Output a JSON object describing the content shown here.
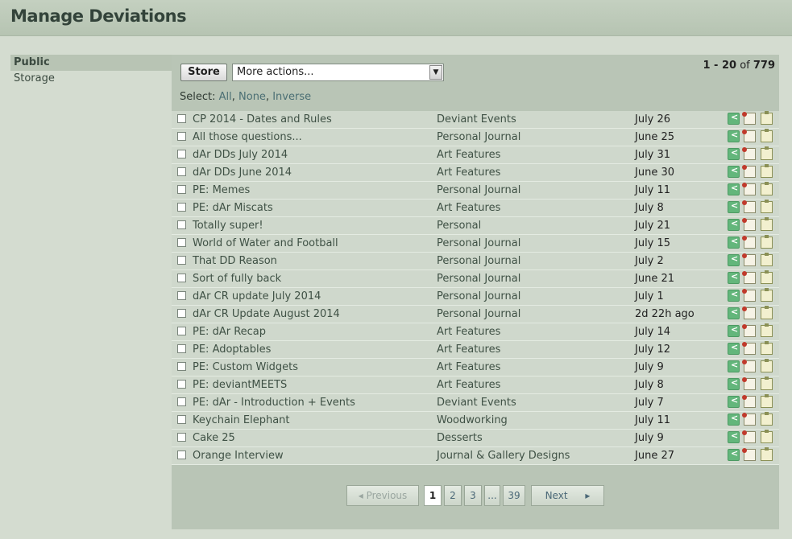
{
  "page": {
    "title": "Manage Deviations"
  },
  "sidebar": {
    "items": [
      {
        "label": "Public"
      },
      {
        "label": "Storage"
      }
    ]
  },
  "toolbar": {
    "store_label": "Store",
    "actions_selected": "More actions...",
    "select_label": "Select:",
    "select_all": "All",
    "select_none": "None",
    "select_inverse": "Inverse",
    "count_range": "1 - 20",
    "count_of": "of",
    "count_total": "779"
  },
  "rows": [
    {
      "title": "CP 2014 - Dates and Rules",
      "category": "Deviant Events",
      "date": "July 26"
    },
    {
      "title": "All those questions...",
      "category": "Personal Journal",
      "date": "June 25"
    },
    {
      "title": "dAr DDs July 2014",
      "category": "Art Features",
      "date": "July 31"
    },
    {
      "title": "dAr DDs June 2014",
      "category": "Art Features",
      "date": "June 30"
    },
    {
      "title": "PE: Memes",
      "category": "Personal Journal",
      "date": "July 11"
    },
    {
      "title": "PE: dAr Miscats",
      "category": "Art Features",
      "date": "July 8"
    },
    {
      "title": "Totally super!",
      "category": "Personal",
      "date": "July 21"
    },
    {
      "title": "World of Water and Football",
      "category": "Personal Journal",
      "date": "July 15"
    },
    {
      "title": "That DD Reason",
      "category": "Personal Journal",
      "date": "July 2"
    },
    {
      "title": "Sort of fully back",
      "category": "Personal Journal",
      "date": "June 21"
    },
    {
      "title": "dAr CR update July 2014",
      "category": "Personal Journal",
      "date": "July 1"
    },
    {
      "title": "dAr CR Update August 2014",
      "category": "Personal Journal",
      "date": "2d 22h ago"
    },
    {
      "title": "PE: dAr Recap",
      "category": "Art Features",
      "date": "July 14"
    },
    {
      "title": "PE: Adoptables",
      "category": "Art Features",
      "date": "July 12"
    },
    {
      "title": "PE: Custom Widgets",
      "category": "Art Features",
      "date": "July 9"
    },
    {
      "title": "PE: deviantMEETS",
      "category": "Art Features",
      "date": "July 8"
    },
    {
      "title": "PE: dAr - Introduction + Events",
      "category": "Deviant Events",
      "date": "July 7"
    },
    {
      "title": "Keychain Elephant",
      "category": "Woodworking",
      "date": "July 11"
    },
    {
      "title": "Cake 25",
      "category": "Desserts",
      "date": "July 9"
    },
    {
      "title": "Orange Interview",
      "category": "Journal & Gallery Designs",
      "date": "June 27"
    }
  ],
  "pager": {
    "previous": "Previous",
    "pages": [
      "1",
      "2",
      "3",
      "...",
      "39"
    ],
    "next": "Next",
    "current": "1"
  },
  "icons": {
    "share": "share-icon",
    "note": "pinned-note-icon",
    "clip": "clipboard-icon"
  }
}
